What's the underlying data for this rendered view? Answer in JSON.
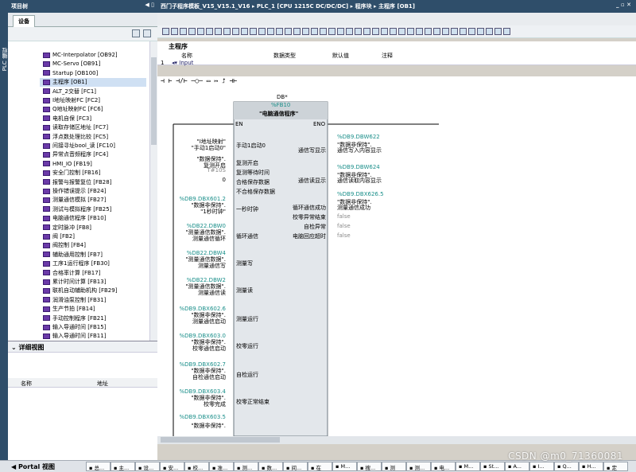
{
  "left_strip": {
    "label": "PLC 编程"
  },
  "project_tree": {
    "title": "项目树",
    "tab": "设备",
    "items": [
      {
        "label": "MC-Interpolator [OB92]"
      },
      {
        "label": "MC-Servo [OB91]"
      },
      {
        "label": "Startup [OB100]"
      },
      {
        "label": "主程序 [OB1]"
      },
      {
        "label": "ALT_2交替 [FC1]"
      },
      {
        "label": "I地址映射FC [FC2]"
      },
      {
        "label": "Q地址映射FC [FC6]"
      },
      {
        "label": "电机自保 [FC3]"
      },
      {
        "label": "读取存储区地址 [FC7]"
      },
      {
        "label": "浮点数处理比较 [FC5]"
      },
      {
        "label": "间接寻址bool_读 [FC10]"
      },
      {
        "label": "异常点音频程序 [FC4]"
      },
      {
        "label": "HMI_IO [FB19]"
      },
      {
        "label": "安全门控制 [FB16]"
      },
      {
        "label": "报警与报警复位 [FB28]"
      },
      {
        "label": "操作错误提示 [FB24]"
      },
      {
        "label": "测量通信模拟 [FB27]"
      },
      {
        "label": "测试与模拟程序 [FB25]"
      },
      {
        "label": "电脑通信程序 [FB10]"
      },
      {
        "label": "定时脉冲 [FB8]"
      },
      {
        "label": "阀 [FB2]"
      },
      {
        "label": "阀控制 [FB4]"
      },
      {
        "label": "辅助通用控制 [FB7]"
      },
      {
        "label": "工序1运行程序 [FB30]"
      },
      {
        "label": "合格率计算 [FB17]"
      },
      {
        "label": "累计时间计算 [FB13]"
      },
      {
        "label": "联机自动辅助机构 [FB29]"
      },
      {
        "label": "润滑油泵控制 [FB31]"
      },
      {
        "label": "生产节拍 [FB14]"
      },
      {
        "label": "手动控制程序 [FB21]"
      },
      {
        "label": "输入导通时间 [FB15]"
      },
      {
        "label": "输入导通时间 [FB11]"
      }
    ]
  },
  "detail_view": {
    "title": "详细视图",
    "col_name": "名称",
    "col_address": "地址"
  },
  "editor": {
    "breadcrumb": "西门子程序模板_V15_V15.1_V16  ▸  PLC_1 [CPU 1215C DC/DC/DC]  ▸  程序块  ▸  主程序 [OB1]",
    "block_title": "主程序",
    "iface_cols": {
      "name": "名称",
      "datatype": "数据类型",
      "default": "默认值",
      "comment": "注释"
    },
    "iface_row_no": "1",
    "iface_row_label": "Input",
    "lad_tools": "⊣ ⊢   ⊣/⊢   ─○─   ▭   ↦   ⮥   ⊣⊢",
    "db_prefix": "DB*"
  },
  "lad_block": {
    "instance": "%FB10",
    "name": "\"电脑通信程序\"",
    "en": "EN",
    "eno": "ENO",
    "inputs": [
      {
        "addr": "",
        "tag1": "\"I地址映射\"",
        "tag2": "\"手动1启动0\"",
        "pin": "手动1启动0"
      },
      {
        "addr": "",
        "tag1": "\"数据保持\".",
        "tag2": "复测开启",
        "pin": "复测开启"
      },
      {
        "addr": "",
        "tag1": "T#10S",
        "tag2": "",
        "pin": "复测等待时间"
      },
      {
        "addr": "",
        "tag1": "0",
        "tag2": "",
        "pin": "合格保存数据"
      },
      {
        "addr": "",
        "tag1": "",
        "tag2": "",
        "pin": "不合格保存数据"
      },
      {
        "addr": "%DB9.DBX601.2",
        "tag1": "\"数据非保持\".",
        "tag2": "\"1秒时钟\"",
        "pin": "一秒时钟"
      },
      {
        "addr": "%DB22.DBW0",
        "tag1": "\"测量通信数据\".",
        "tag2": "测量通信循环",
        "pin": "循环通信"
      },
      {
        "addr": "%DB22.DBW4",
        "tag1": "\"测量通信数据\".",
        "tag2": "测量通信写",
        "pin": "测量写"
      },
      {
        "addr": "%DB22.DBW2",
        "tag1": "\"测量通信数据\".",
        "tag2": "测量通信读",
        "pin": "测量读"
      },
      {
        "addr": "%DB9.DBX602.6",
        "tag1": "\"数据非保持\".",
        "tag2": "测量通信启动",
        "pin": "测量运行"
      },
      {
        "addr": "%DB9.DBX603.0",
        "tag1": "\"数据非保持\".",
        "tag2": "校零通信启动",
        "pin": "校零运行"
      },
      {
        "addr": "%DB9.DBX602.7",
        "tag1": "\"数据非保持\".",
        "tag2": "自检通信启动",
        "pin": "自检运行"
      },
      {
        "addr": "%DB9.DBX603.4",
        "tag1": "\"数据非保持\".",
        "tag2": "校零完成",
        "pin": "校零正常结束"
      },
      {
        "addr": "%DB9.DBX603.5",
        "tag1": "\"数据非保持\".",
        "tag2": "",
        "pin": ""
      }
    ],
    "outputs": [
      {
        "pin": "通信写显示",
        "addr": "%DB9.DBW622",
        "tag1": "\"数据非保持\".",
        "tag2": "通信写入内容显示"
      },
      {
        "pin": "通信读显示",
        "addr": "%DB9.DBW624",
        "tag1": "\"数据非保持\".",
        "tag2": "通信读取内容显示"
      },
      {
        "pin": "循环通信成功",
        "addr": "%DB9.DBX626.5",
        "tag1": "\"数据非保持\".",
        "tag2": "测量通信成功"
      },
      {
        "pin": "校零异常结束",
        "addr": "",
        "tag1": "false",
        "tag2": ""
      },
      {
        "pin": "自检异常",
        "addr": "",
        "tag1": "false",
        "tag2": ""
      },
      {
        "pin": "电脑回应超时",
        "addr": "",
        "tag1": "false",
        "tag2": ""
      }
    ]
  },
  "statusbar": {
    "portal": "◀  Portal 视图",
    "tasks": [
      "总...",
      "主...",
      "设...",
      "安...",
      "校...",
      "准...",
      "测...",
      "数...",
      "间...",
      "在",
      "M...",
      "搜...",
      "测",
      "测...",
      "电...",
      "M...",
      "St...",
      "A...",
      "I...",
      "Q...",
      "H...",
      "定"
    ],
    "watermark": "CSDN @m0_71360081"
  }
}
